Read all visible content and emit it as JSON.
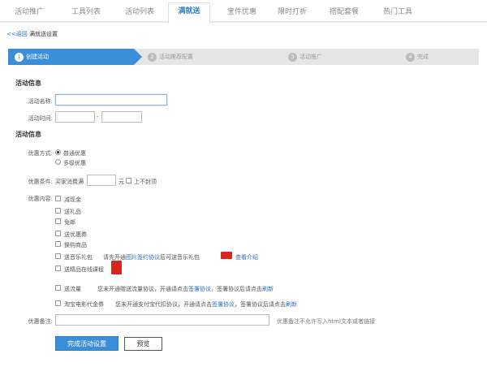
{
  "tabs": [
    {
      "label": "活动推广"
    },
    {
      "label": "工具列表"
    },
    {
      "label": "活动列表"
    },
    {
      "label": "满就送"
    },
    {
      "label": "宝件优惠"
    },
    {
      "label": "限时打折"
    },
    {
      "label": "搭配套餐"
    },
    {
      "label": "热门工具"
    }
  ],
  "breadcrumb": {
    "back": "<<返回",
    "current": "满就送设置"
  },
  "steps": [
    {
      "num": "1",
      "label": "创建活动"
    },
    {
      "num": "2",
      "label": "活动推荐配置"
    },
    {
      "num": "3",
      "label": "活动推广"
    },
    {
      "num": "4",
      "label": "完成"
    }
  ],
  "activity_info": {
    "title": "活动信息",
    "name_label": "活动名称:",
    "name_value": "",
    "time_label": "活动时间:",
    "start_value": "",
    "separator": "-",
    "end_value": ""
  },
  "promo_info": {
    "title": "活动信息",
    "method_label": "优惠方式:",
    "method_options": [
      "普通优惠",
      "多级优惠"
    ],
    "condition_label": "优惠条件:",
    "condition_prefix": "买家消费满",
    "condition_value": "",
    "condition_unit": "元",
    "no_limit_label": "上不封顶",
    "content_label": "优惠内容:",
    "items": [
      {
        "label": "减现金"
      },
      {
        "label": "送礼品"
      },
      {
        "label": "免邮"
      },
      {
        "label": "送优惠券"
      },
      {
        "label": "换购商品"
      }
    ],
    "lottery": {
      "label": "送音乐礼包",
      "note1": "请先开通",
      "note_link": "图片签约协议",
      "note2": "后可送音乐礼包",
      "view_link": "查看介绍"
    },
    "ticket": {
      "label": "送精品在线课程"
    },
    "traffic": {
      "label": "送流量",
      "note1": "您未开通赠送流量协议，开通请点击",
      "link1": "签署协议",
      "note2": "，签署协议后请点击",
      "link2": "刷新"
    },
    "movie": {
      "label": "淘宝电影代金券",
      "note1": "您未开通支付宝代扣协议，开通请点击",
      "link1": "签署协议",
      "note2": "，签署协议后请点击",
      "link2": "刷新"
    },
    "remark_label": "优惠备注:",
    "remark_value": "",
    "remark_hint": "优惠备注不允许写入html文本或者链接"
  },
  "buttons": {
    "submit": "完成活动设置",
    "preview": "预览"
  },
  "colors": {
    "accent": "#3b8fd9",
    "link": "#2a6fbf",
    "gift_red": "#d9251d"
  }
}
